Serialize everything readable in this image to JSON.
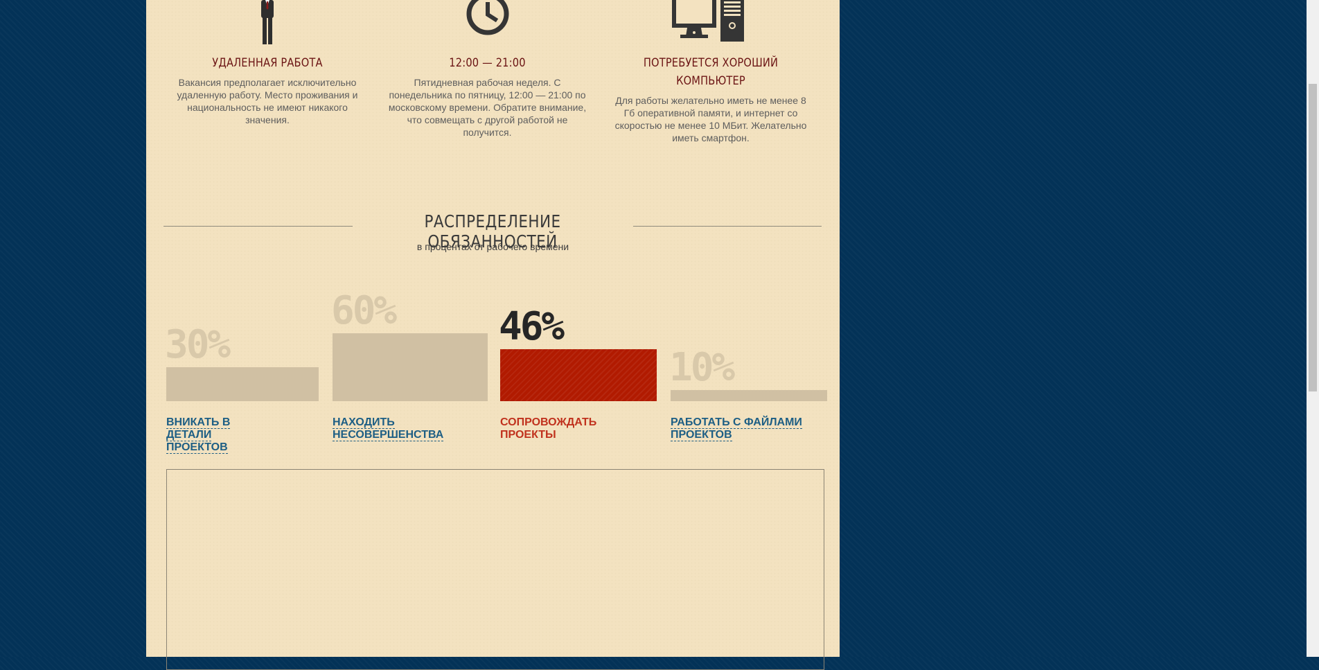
{
  "features": [
    {
      "icon": "businessman-icon",
      "title": "УДАЛЕННАЯ РАБОТА",
      "description": "Вакансия предполагает исключительно удаленную работу. Место проживания и национальность не имеют никакого значения."
    },
    {
      "icon": "clock-icon",
      "title": "12:00 — 21:00",
      "description": "Пятидневная рабочая неделя. С понедельника по пятницу, 12:00 — 21:00 по московскому времени. Обратите внимание, что совмещать с другой работой не получится."
    },
    {
      "icon": "computer-icon",
      "title": "ПОТРЕБУЕТСЯ ХОРОШИЙ КОМПЬЮТЕР",
      "description": "Для работы желательно иметь не менее 8 Гб оперативной памяти, и интернет со скоростью не менее 10 МБит. Желательно иметь смартфон."
    }
  ],
  "duties": {
    "title": "РАСПРЕДЕЛЕНИЕ ОБЯЗАННОСТЕЙ",
    "subtitle": "в процентах от рабочего времени",
    "items": [
      {
        "percent": 30,
        "label": "30%",
        "text": "ВНИКАТЬ В ДЕТАЛИ ПРОЕКТОВ",
        "active": false
      },
      {
        "percent": 60,
        "label": "60%",
        "text": "НАХОДИТЬ НЕСОВЕРШЕНСТВА",
        "active": false
      },
      {
        "percent": 46,
        "label": "46%",
        "text": "СОПРОВОЖДАТЬ ПРОЕКТЫ",
        "active": true
      },
      {
        "percent": 10,
        "label": "10%",
        "text": "РАБОТАТЬ С ФАЙЛАМИ ПРОЕКТОВ",
        "active": false
      }
    ]
  },
  "colors": {
    "background": "#033257",
    "paper": "#f3e2c0",
    "bar_inactive": "#d0c0a3",
    "bar_active": "#b11a00",
    "label_link": "#1d5e84",
    "label_active": "#c0311d",
    "title": "#6b1414"
  }
}
